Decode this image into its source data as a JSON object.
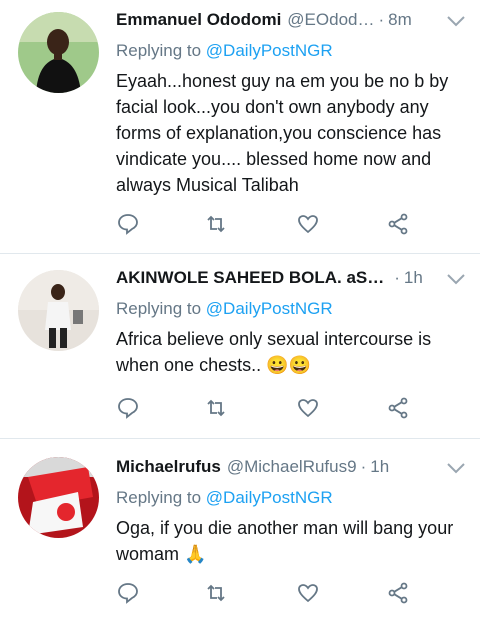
{
  "tweets": [
    {
      "name": "Emmanuel Ododomi",
      "handle": "@EOdod…",
      "sep": "·",
      "time": "8m",
      "replying_prefix": "Replying to",
      "replying_to": "@DailyPostNGR",
      "text": "Eyaah...honest guy na em you be no b by facial look...you don't own anybody any forms of explanation,you conscience has vindicate you.... blessed home now and always Musical Talibah"
    },
    {
      "name": "AKINWOLE SAHEED BOLA. aS…",
      "handle": "",
      "sep": "·",
      "time": "1h",
      "replying_prefix": "Replying to",
      "replying_to": "@DailyPostNGR",
      "text": "Africa believe only sexual intercourse is when one chests.. 😀😀"
    },
    {
      "name": "Michaelrufus",
      "handle": "@MichaelRufus9",
      "sep": "·",
      "time": "1h",
      "replying_prefix": "Replying to",
      "replying_to": "@DailyPostNGR",
      "text": "Oga, if you die another man will bang your womam 🙏"
    }
  ],
  "icons": {
    "reply": "reply-icon",
    "retweet": "retweet-icon",
    "like": "heart-icon",
    "share": "share-icon",
    "menu": "chevron-down-icon"
  },
  "colors": {
    "link": "#1da1f2",
    "muted": "#657786",
    "icon": "#657786",
    "divider": "#e1e8ed"
  }
}
